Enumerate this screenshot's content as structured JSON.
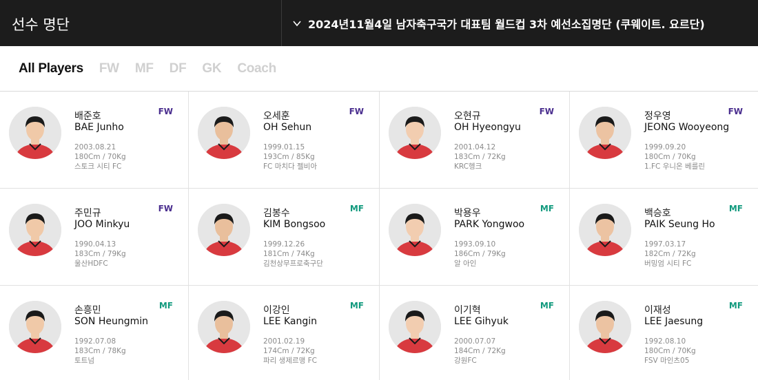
{
  "header": {
    "title": "선수 명단",
    "selector_label": "2024년11월4일 남자축구국가 대표팀 월드컵 3차 예선소집명단 (쿠웨이트. 요르단)",
    "selector_icon": "chevron-down-icon"
  },
  "tabs": [
    {
      "label": "All Players",
      "active": true
    },
    {
      "label": "FW",
      "active": false
    },
    {
      "label": "MF",
      "active": false
    },
    {
      "label": "DF",
      "active": false
    },
    {
      "label": "GK",
      "active": false
    },
    {
      "label": "Coach",
      "active": false
    }
  ],
  "colors": {
    "fw": "#4b2f8f",
    "mf": "#129a7e",
    "kit": "#d83a3f"
  },
  "players": [
    {
      "name_ko": "배준호",
      "name_en": "BAE Junho",
      "position": "FW",
      "birth": "2003.08.21",
      "body": "180Cm / 70Kg",
      "club": "스토크 시티 FC"
    },
    {
      "name_ko": "오세훈",
      "name_en": "OH Sehun",
      "position": "FW",
      "birth": "1999.01.15",
      "body": "193Cm / 85Kg",
      "club": "FC 마치다 젤비아"
    },
    {
      "name_ko": "오현규",
      "name_en": "OH Hyeongyu",
      "position": "FW",
      "birth": "2001.04.12",
      "body": "183Cm / 72Kg",
      "club": "KRC헹크"
    },
    {
      "name_ko": "정우영",
      "name_en": "JEONG Wooyeong",
      "position": "FW",
      "birth": "1999.09.20",
      "body": "180Cm / 70Kg",
      "club": "1.FC 우니온 베를린"
    },
    {
      "name_ko": "주민규",
      "name_en": "JOO Minkyu",
      "position": "FW",
      "birth": "1990.04.13",
      "body": "183Cm / 79Kg",
      "club": "울산HDFC"
    },
    {
      "name_ko": "김봉수",
      "name_en": "KIM Bongsoo",
      "position": "MF",
      "birth": "1999.12.26",
      "body": "181Cm / 74Kg",
      "club": "김천상무프로축구단"
    },
    {
      "name_ko": "박용우",
      "name_en": "PARK Yongwoo",
      "position": "MF",
      "birth": "1993.09.10",
      "body": "186Cm / 79Kg",
      "club": "알 아인"
    },
    {
      "name_ko": "백승호",
      "name_en": "PAIK Seung Ho",
      "position": "MF",
      "birth": "1997.03.17",
      "body": "182Cm / 72Kg",
      "club": "버밍엄 시티 FC"
    },
    {
      "name_ko": "손흥민",
      "name_en": "SON Heungmin",
      "position": "MF",
      "birth": "1992.07.08",
      "body": "183Cm / 78Kg",
      "club": "토트넘"
    },
    {
      "name_ko": "이강인",
      "name_en": "LEE Kangin",
      "position": "MF",
      "birth": "2001.02.19",
      "body": "174Cm / 72Kg",
      "club": "파리 생제르맹 FC"
    },
    {
      "name_ko": "이기혁",
      "name_en": "LEE Gihyuk",
      "position": "MF",
      "birth": "2000.07.07",
      "body": "184Cm / 72Kg",
      "club": "강원FC"
    },
    {
      "name_ko": "이재성",
      "name_en": "LEE Jaesung",
      "position": "MF",
      "birth": "1992.08.10",
      "body": "180Cm / 70Kg",
      "club": "FSV 마인츠05"
    }
  ]
}
